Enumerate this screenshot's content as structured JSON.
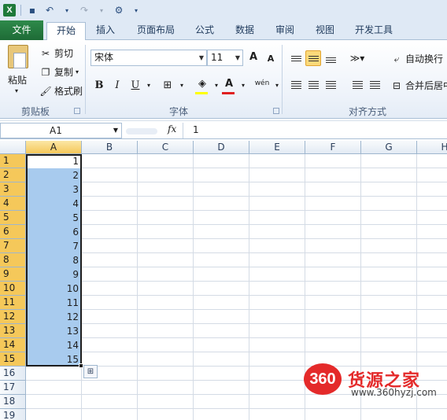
{
  "qat": {
    "app_icon": "X",
    "undo": "↶",
    "redo": "↷",
    "customize": "⚙"
  },
  "tabs": [
    {
      "label": "文件",
      "name": "tab-file"
    },
    {
      "label": "开始",
      "name": "tab-home"
    },
    {
      "label": "插入",
      "name": "tab-insert"
    },
    {
      "label": "页面布局",
      "name": "tab-page-layout"
    },
    {
      "label": "公式",
      "name": "tab-formulas"
    },
    {
      "label": "数据",
      "name": "tab-data"
    },
    {
      "label": "审阅",
      "name": "tab-review"
    },
    {
      "label": "视图",
      "name": "tab-view"
    },
    {
      "label": "开发工具",
      "name": "tab-developer"
    }
  ],
  "ribbon": {
    "clipboard": {
      "paste": "粘贴",
      "cut": "剪切",
      "copy": "复制",
      "format_painter": "格式刷",
      "group": "剪贴板"
    },
    "font": {
      "name": "宋体",
      "size": "11",
      "bold": "B",
      "italic": "I",
      "underline": "U",
      "grow": "A",
      "shrink": "A",
      "phonetic": "wén",
      "group": "字体"
    },
    "alignment": {
      "wrap": "自动换行",
      "merge": "合并后居中",
      "group": "对齐方式"
    }
  },
  "formula_bar": {
    "name_box": "A1",
    "fx": "fx",
    "content": "1"
  },
  "sheet": {
    "columns": [
      "A",
      "B",
      "C",
      "D",
      "E",
      "F",
      "G",
      "H"
    ],
    "rows": [
      "1",
      "2",
      "3",
      "4",
      "5",
      "6",
      "7",
      "8",
      "9",
      "10",
      "11",
      "12",
      "13",
      "14",
      "15",
      "16",
      "17",
      "18",
      "19"
    ],
    "column_a_values": [
      "1",
      "2",
      "3",
      "4",
      "5",
      "6",
      "7",
      "8",
      "9",
      "10",
      "11",
      "12",
      "13",
      "14",
      "15"
    ]
  },
  "watermark": {
    "badge": "360",
    "title": "货源之家",
    "url": "www.360hyzj.com"
  }
}
